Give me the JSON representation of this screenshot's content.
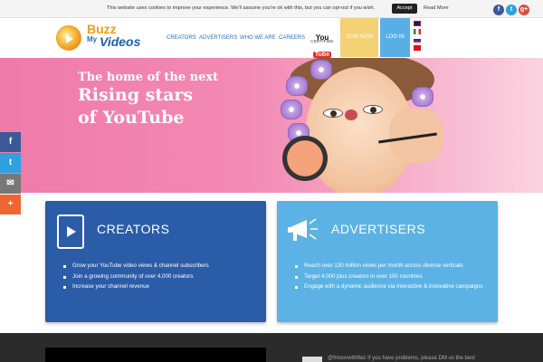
{
  "cookie_bar": {
    "message": "This website uses cookies to improve your experience. We'll assume you're ok with this, but you can opt-out if you wish.",
    "accept_label": "Accept",
    "read_more_label": "Read More"
  },
  "social_top": [
    {
      "icon": "facebook-icon",
      "glyph": "f",
      "color": "#3b5998"
    },
    {
      "icon": "twitter-icon",
      "glyph": "t",
      "color": "#2fa0e0"
    },
    {
      "icon": "google-plus-icon",
      "glyph": "g+",
      "color": "#dd4b39"
    }
  ],
  "header": {
    "logo_buzz": "Buzz",
    "logo_my": "My",
    "logo_videos": "Videos",
    "nav": [
      "CREATORS",
      "ADVERTISERS",
      "WHO WE ARE",
      "CAREERS"
    ],
    "youtube_you": "You",
    "youtube_tube": "Tube",
    "youtube_certified": "CERTIFIED",
    "join_label": "JOIN NOW",
    "login_label": "LOG IN",
    "flags": [
      {
        "icon": "uk-flag-icon"
      },
      {
        "icon": "italy-flag-icon"
      },
      {
        "icon": "russia-flag-icon"
      },
      {
        "icon": "turkey-flag-icon"
      }
    ]
  },
  "hero": {
    "line1": "The home of the next",
    "line2": "Rising stars",
    "line3": "of YouTube"
  },
  "share_bar": [
    {
      "icon": "facebook-share-icon",
      "glyph": "f",
      "color": "#3b5998"
    },
    {
      "icon": "twitter-share-icon",
      "glyph": "t",
      "color": "#2fa0e0"
    },
    {
      "icon": "email-share-icon",
      "glyph": "✉",
      "color": "#777777"
    },
    {
      "icon": "more-share-icon",
      "glyph": "+",
      "color": "#f0652f"
    }
  ],
  "creators": {
    "title": "CREATORS",
    "icon": "tablet-play-icon",
    "bullets": [
      "Grow your YouTube video views & channel subscribers",
      "Join a growing community of over 4,000 creators",
      "Increase your channel revenue"
    ]
  },
  "advertisers": {
    "title": "ADVERTISERS",
    "icon": "megaphone-icon",
    "bullets": [
      "Reach over 130 million views per month across diverse verticals",
      "Target 4,000 plus creators in over 100 countries",
      "Engage with a dynamic audience via interactive & innovative campaigns"
    ]
  },
  "footer": {
    "tweet_text": "@fmoovwithfiez If you have problems, please DM us the best"
  },
  "colors": {
    "brand_blue": "#2b5ca7",
    "light_blue": "#5cb2e4",
    "join_yellow": "#f3d174",
    "hero_pink": "#f07aaa"
  }
}
